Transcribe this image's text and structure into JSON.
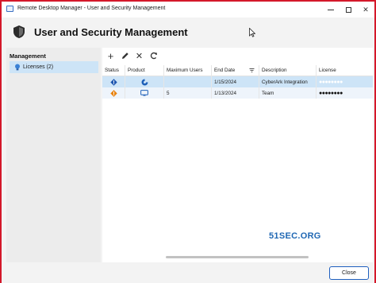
{
  "window": {
    "title": "Remote Desktop Manager - User and Security Management",
    "controls": {
      "minimize": "minimize-icon",
      "maximize": "maximize-icon",
      "close": "✕"
    }
  },
  "header": {
    "title": "User and Security Management",
    "icon": "shield-icon"
  },
  "sidebar": {
    "heading": "Management",
    "items": [
      {
        "label": "Licenses (2)",
        "icon": "lightbulb-icon",
        "selected": true
      }
    ]
  },
  "toolbar": {
    "add": "+",
    "edit": "pencil-icon",
    "delete": "✕",
    "refresh": "refresh-icon"
  },
  "grid": {
    "columns": [
      "Status",
      "Product",
      "Maximum Users",
      "End Date",
      "Description",
      "License"
    ],
    "filter_icon": "filter-icon",
    "rows": [
      {
        "status_icon": "warning-blue-icon",
        "product_icon": "cyberark-icon",
        "max_users": "",
        "end_date": "1/15/2024",
        "description": "CyberArk Integration",
        "license": "●●●●●●●●",
        "selected": true
      },
      {
        "status_icon": "warning-orange-icon",
        "product_icon": "monitor-icon",
        "max_users": "5",
        "end_date": "1/13/2024",
        "description": "Team",
        "license": "●●●●●●●●",
        "selected": false
      }
    ]
  },
  "watermark": "51SEC.ORG",
  "footer": {
    "close_label": "Close"
  },
  "colors": {
    "accent": "#1f5fbf",
    "selected_row": "#cde4f7",
    "border": "#d4182a"
  }
}
